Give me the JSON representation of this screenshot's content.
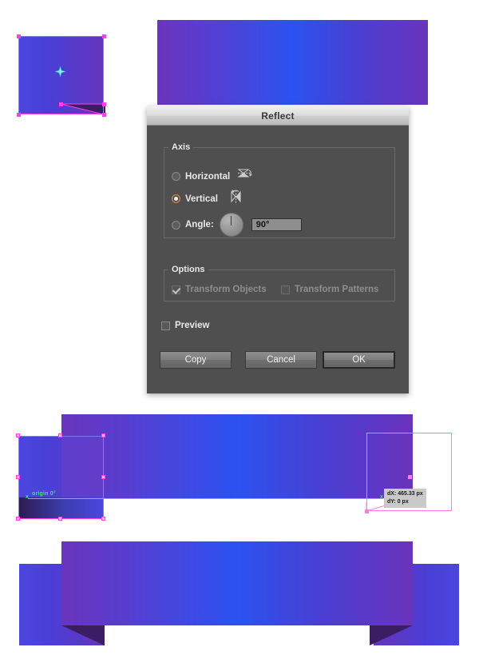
{
  "app": {
    "context": "vector-illustration-canvas"
  },
  "dialog": {
    "title": "Reflect",
    "axis": {
      "legend": "Axis",
      "options": [
        {
          "label": "Horizontal",
          "selected": false,
          "icon": "reflect-horizontal-icon"
        },
        {
          "label": "Vertical",
          "selected": true,
          "icon": "reflect-vertical-icon"
        }
      ],
      "angle": {
        "label": "Angle:",
        "selected": false,
        "value": "90°",
        "dial_icon": "angle-dial-icon"
      }
    },
    "options": {
      "legend": "Options",
      "items": [
        {
          "label": "Transform Objects",
          "checked": true,
          "enabled": false
        },
        {
          "label": "Transform Patterns",
          "checked": false,
          "enabled": false
        }
      ]
    },
    "preview": {
      "label": "Preview",
      "checked": false
    },
    "buttons": [
      {
        "id": "copy",
        "label": "Copy",
        "default": false
      },
      {
        "id": "cancel",
        "label": "Cancel",
        "default": false
      },
      {
        "id": "ok",
        "label": "OK",
        "default": true
      }
    ]
  },
  "canvas": {
    "smart_guides": {
      "origin_label": "origin 0°",
      "origin_x_mark": "x"
    },
    "measurement_tooltip": {
      "dx": "dX: 465.33 px",
      "dy": "dY: 0 px"
    }
  },
  "colors": {
    "ribbon_purple": "#6b34bd",
    "ribbon_blue": "#2b52f0",
    "ribbon_tail_blue": "#4b46e0",
    "notch_shadow": "#3a1d63",
    "selection_magenta": "#ff3ff0",
    "ghost_outline": "#ff7ae8",
    "smart_guide_green": "#46e37a",
    "radio_accent": "#e08c28",
    "dialog_bg": "#4f4f4f",
    "titlebar_text": "#3a3a3a",
    "tooltip_bg": "#c9c9c9"
  }
}
